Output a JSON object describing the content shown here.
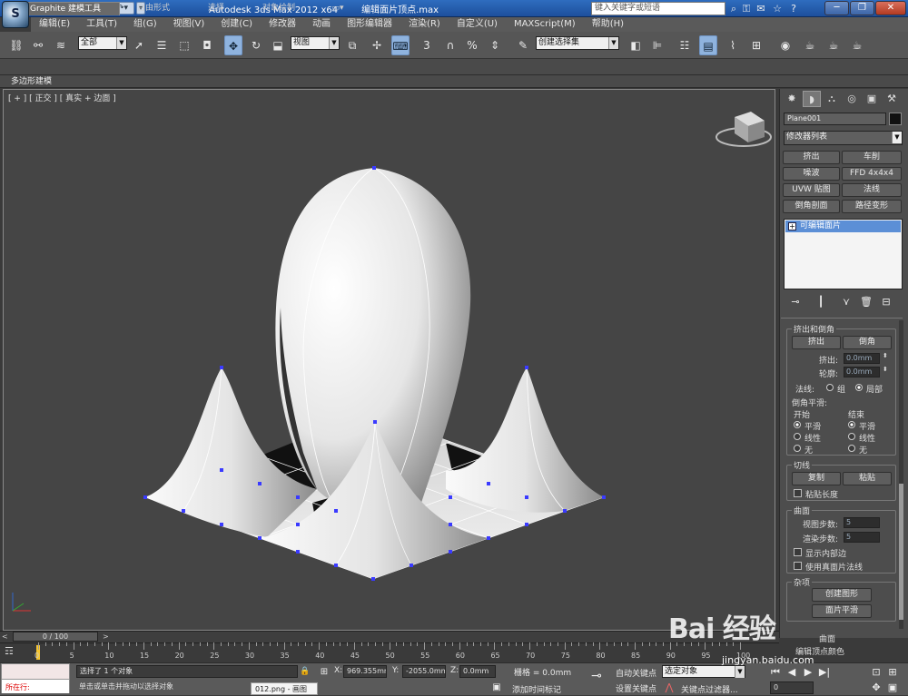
{
  "title_bar": {
    "app_title": "Autodesk 3ds Max  2012 x64",
    "file_name": "编辑面片顶点.max",
    "search_placeholder": "键入关键字或短语",
    "logo_text": "S",
    "minimize": "─",
    "restore": "❐",
    "close": "✕"
  },
  "menu": [
    "编辑(E)",
    "工具(T)",
    "组(G)",
    "视图(V)",
    "创建(C)",
    "修改器",
    "动画",
    "图形编辑器",
    "渲染(R)",
    "自定义(U)",
    "MAXScript(M)",
    "帮助(H)"
  ],
  "toolbar": {
    "selection_filter": "全部",
    "reference_coord": "视图",
    "named_selection": "创建选择集",
    "snap_label": "3",
    "angle_snap": "%"
  },
  "ribbon": {
    "tabs": [
      "Graphite 建模工具",
      "自由形式",
      "选择",
      "对象绘制"
    ],
    "subtitle": "多边形建模"
  },
  "viewport": {
    "label": "[ + ] [ 正交 ] [ 真实 + 边面 ]"
  },
  "command_panel": {
    "object_name": "Plane001",
    "modifier_list": "修改器列表",
    "modifier_buttons": [
      "挤出",
      "车削",
      "噪波",
      "FFD 4x4x4",
      "UVW 贴图",
      "法线",
      "倒角剖面",
      "路径变形"
    ],
    "stack_item": "可编辑面片",
    "extrude_group": {
      "title": "挤出和倒角",
      "extrude_btn": "挤出",
      "bevel_btn": "倒角",
      "extrude_label": "挤出:",
      "extrude_value": "0.0mm",
      "outline_label": "轮廓:",
      "outline_value": "0.0mm",
      "normal_label": "法线:",
      "normal_group": "组",
      "normal_local": "局部",
      "bevel_smooth": "倒角平滑:",
      "start": "开始",
      "end": "结束",
      "smooth": "平滑",
      "linear": "线性",
      "none": "无"
    },
    "tangent_group": {
      "title": "切线",
      "copy": "复制",
      "paste": "粘贴",
      "paste_length": "粘贴长度"
    },
    "surface_group": {
      "title": "曲面",
      "view_steps_label": "视图步数:",
      "view_steps": "5",
      "render_steps_label": "渲染步数:",
      "render_steps": "5",
      "show_interior": "显示内部边",
      "use_true_normals": "使用真面片法线"
    },
    "misc_group": {
      "title": "杂项",
      "create_shape": "创建图形",
      "patch_smooth": "面片平滑"
    },
    "bottom_group": {
      "title": "曲面",
      "sub": "编辑顶点颜色"
    }
  },
  "timeline": {
    "frame": "0 / 100",
    "ticks": [
      "0",
      "5",
      "10",
      "15",
      "20",
      "25",
      "30",
      "35",
      "40",
      "45",
      "50",
      "55",
      "60",
      "65",
      "70",
      "75",
      "80",
      "85",
      "90",
      "95",
      "100"
    ]
  },
  "status": {
    "maxscript_label": "所在行:",
    "selection_text": "选择了 1 个对象",
    "prompt_text": "单击或单击并拖动以选择对象",
    "x_label": "X:",
    "x_value": "969.355mm",
    "y_label": "Y:",
    "y_value": "-2055.0mm",
    "z_label": "Z:",
    "z_value": "0.0mm",
    "grid_text": "栅格 = 0.0mm",
    "add_time_tag": "添加时间标记",
    "auto_key": "自动关键点",
    "set_key": "设置关键点",
    "selected_dropdown": "选定对象",
    "key_filters": "关键点过滤器...",
    "frame_value": "0",
    "taskbar_tip": "012.png - 画图"
  },
  "watermark": {
    "brand": "Bai 经验",
    "url": "jingyan.baidu.com"
  }
}
